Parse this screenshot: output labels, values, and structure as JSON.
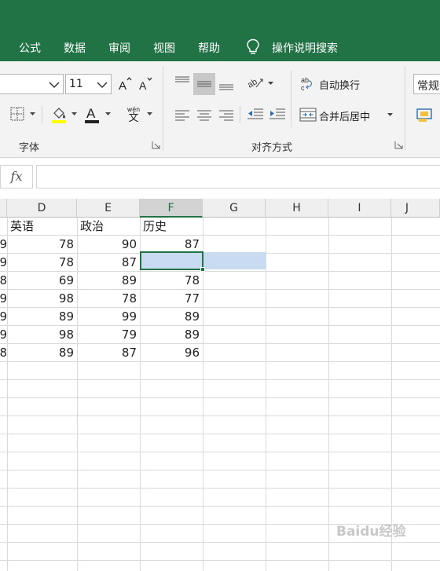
{
  "menu": {
    "items": [
      "公式",
      "数据",
      "审阅",
      "视图",
      "帮助"
    ],
    "tell_me": "操作说明搜索"
  },
  "ribbon": {
    "font_size": "11",
    "wrap_text": "自动换行",
    "merge_center": "合并后居中",
    "number_format": "常规",
    "group_font": "字体",
    "group_align": "对齐方式",
    "pinyin_top": "wén",
    "pinyin_char": "文"
  },
  "formula_bar": {
    "fx": "fx",
    "content": ""
  },
  "grid": {
    "columns": [
      "D",
      "E",
      "F",
      "G",
      "H",
      "I",
      "J"
    ],
    "selected_column": "F",
    "headers_row": [
      "英语",
      "政治",
      "历史"
    ],
    "row_stubs": [
      "9",
      "9",
      "8",
      "9",
      "9",
      "9",
      "8"
    ],
    "rows": [
      [
        "78",
        "90",
        "87"
      ],
      [
        "78",
        "87",
        ""
      ],
      [
        "69",
        "89",
        "78"
      ],
      [
        "98",
        "78",
        "77"
      ],
      [
        "89",
        "99",
        "89"
      ],
      [
        "98",
        "79",
        "89"
      ],
      [
        "89",
        "87",
        "96"
      ]
    ]
  },
  "watermark": "Baidu经验",
  "colors": {
    "accent": "#217346",
    "selection": "#c9dbf0"
  }
}
